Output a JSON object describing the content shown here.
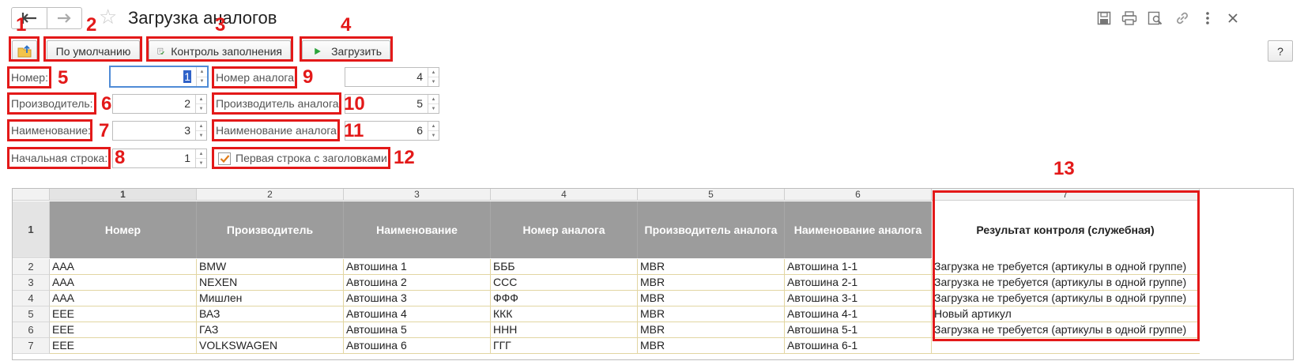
{
  "header": {
    "title": "Загрузка аналогов",
    "nav_back_icon": "arrow-left-icon",
    "nav_forward_icon": "arrow-right-icon",
    "favorite_icon": "star-icon",
    "top_icons": [
      "save-icon",
      "print-icon",
      "preview-icon",
      "link-icon",
      "more-icon",
      "close-icon"
    ]
  },
  "toolbar": {
    "upload_icon": "upload-folder-icon",
    "default_label": "По умолчанию",
    "check_label": "Контроль заполнения",
    "load_label": "Загрузить",
    "help_label": "?"
  },
  "form": {
    "number_label": "Номер:",
    "number_value": "1",
    "maker_label": "Производитель:",
    "maker_value": "2",
    "name_label": "Наименование:",
    "name_value": "3",
    "start_row_label": "Начальная строка:",
    "start_row_value": "1",
    "analog_number_label": "Номер аналога:",
    "analog_number_value": "4",
    "analog_maker_label": "Производитель аналога:",
    "analog_maker_value": "5",
    "analog_name_label": "Наименование аналога:",
    "analog_name_value": "6",
    "first_row_headers_label": "Первая строка с заголовками",
    "first_row_headers_checked": true
  },
  "annotations": [
    "1",
    "2",
    "3",
    "4",
    "5",
    "6",
    "7",
    "8",
    "9",
    "10",
    "11",
    "12",
    "13"
  ],
  "table": {
    "column_numbers": [
      "1",
      "2",
      "3",
      "4",
      "5",
      "6",
      "7"
    ],
    "header_row_number": "1",
    "headers": [
      "Номер",
      "Производитель",
      "Наименование",
      "Номер аналога",
      "Производитель аналога",
      "Наименование аналога",
      "Результат контроля (служебная)"
    ],
    "rows": [
      {
        "n": "2",
        "cells": [
          "AAA",
          "BMW",
          "Автошина 1",
          "БББ",
          "MBR",
          "Автошина 1-1",
          "Загрузка не требуется (артикулы в одной группе)"
        ]
      },
      {
        "n": "3",
        "cells": [
          "AAA",
          "NEXEN",
          "Автошина 2",
          "CCC",
          "MBR",
          "Автошина 2-1",
          "Загрузка не требуется (артикулы в одной группе)"
        ]
      },
      {
        "n": "4",
        "cells": [
          "AAA",
          "Мишлен",
          "Автошина 3",
          "ФФФ",
          "MBR",
          "Автошина 3-1",
          "Загрузка не требуется (артикулы в одной группе)"
        ]
      },
      {
        "n": "5",
        "cells": [
          "EEE",
          "ВАЗ",
          "Автошина 4",
          "ККК",
          "MBR",
          "Автошина 4-1",
          "Новый артикул"
        ]
      },
      {
        "n": "6",
        "cells": [
          "EEE",
          "ГАЗ",
          "Автошина 5",
          "ННН",
          "MBR",
          "Автошина 5-1",
          "Загрузка не требуется (артикулы в одной группе)"
        ]
      },
      {
        "n": "7",
        "cells": [
          "EEE",
          "VOLKSWAGEN",
          "Автошина 6",
          "ГГГ",
          "MBR",
          "Автошина 6-1",
          ""
        ]
      }
    ]
  }
}
